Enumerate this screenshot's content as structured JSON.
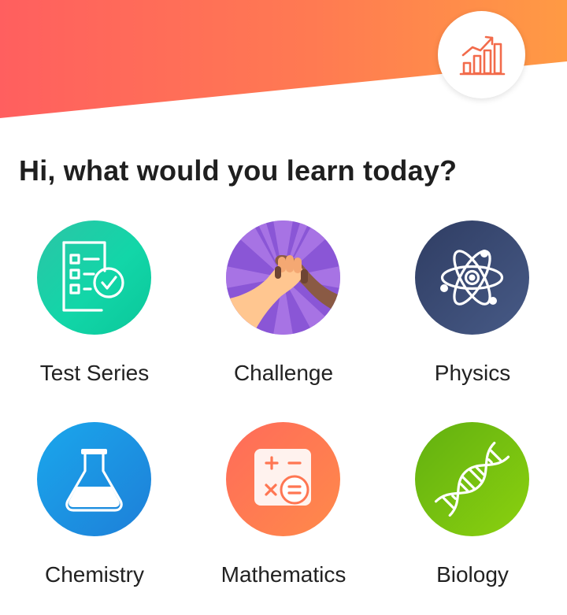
{
  "header": {
    "progress_icon": "growth-chart-icon",
    "gradient_colors": [
      "#ff6b5e",
      "#ff8a4c",
      "#ffa33f"
    ]
  },
  "greeting": "Hi, what would you learn today?",
  "subjects": [
    {
      "label": "Test Series",
      "icon": "checklist-icon",
      "color": "#12d6a8"
    },
    {
      "label": "Challenge",
      "icon": "handshake-icon",
      "color": "#8a56d6"
    },
    {
      "label": "Physics",
      "icon": "atom-icon",
      "color": "#3b4b74"
    },
    {
      "label": "Chemistry",
      "icon": "flask-icon",
      "color": "#1a8fe2"
    },
    {
      "label": "Mathematics",
      "icon": "calculator-icon",
      "color": "#ff7652"
    },
    {
      "label": "Biology",
      "icon": "dna-icon",
      "color": "#76c10f"
    }
  ]
}
